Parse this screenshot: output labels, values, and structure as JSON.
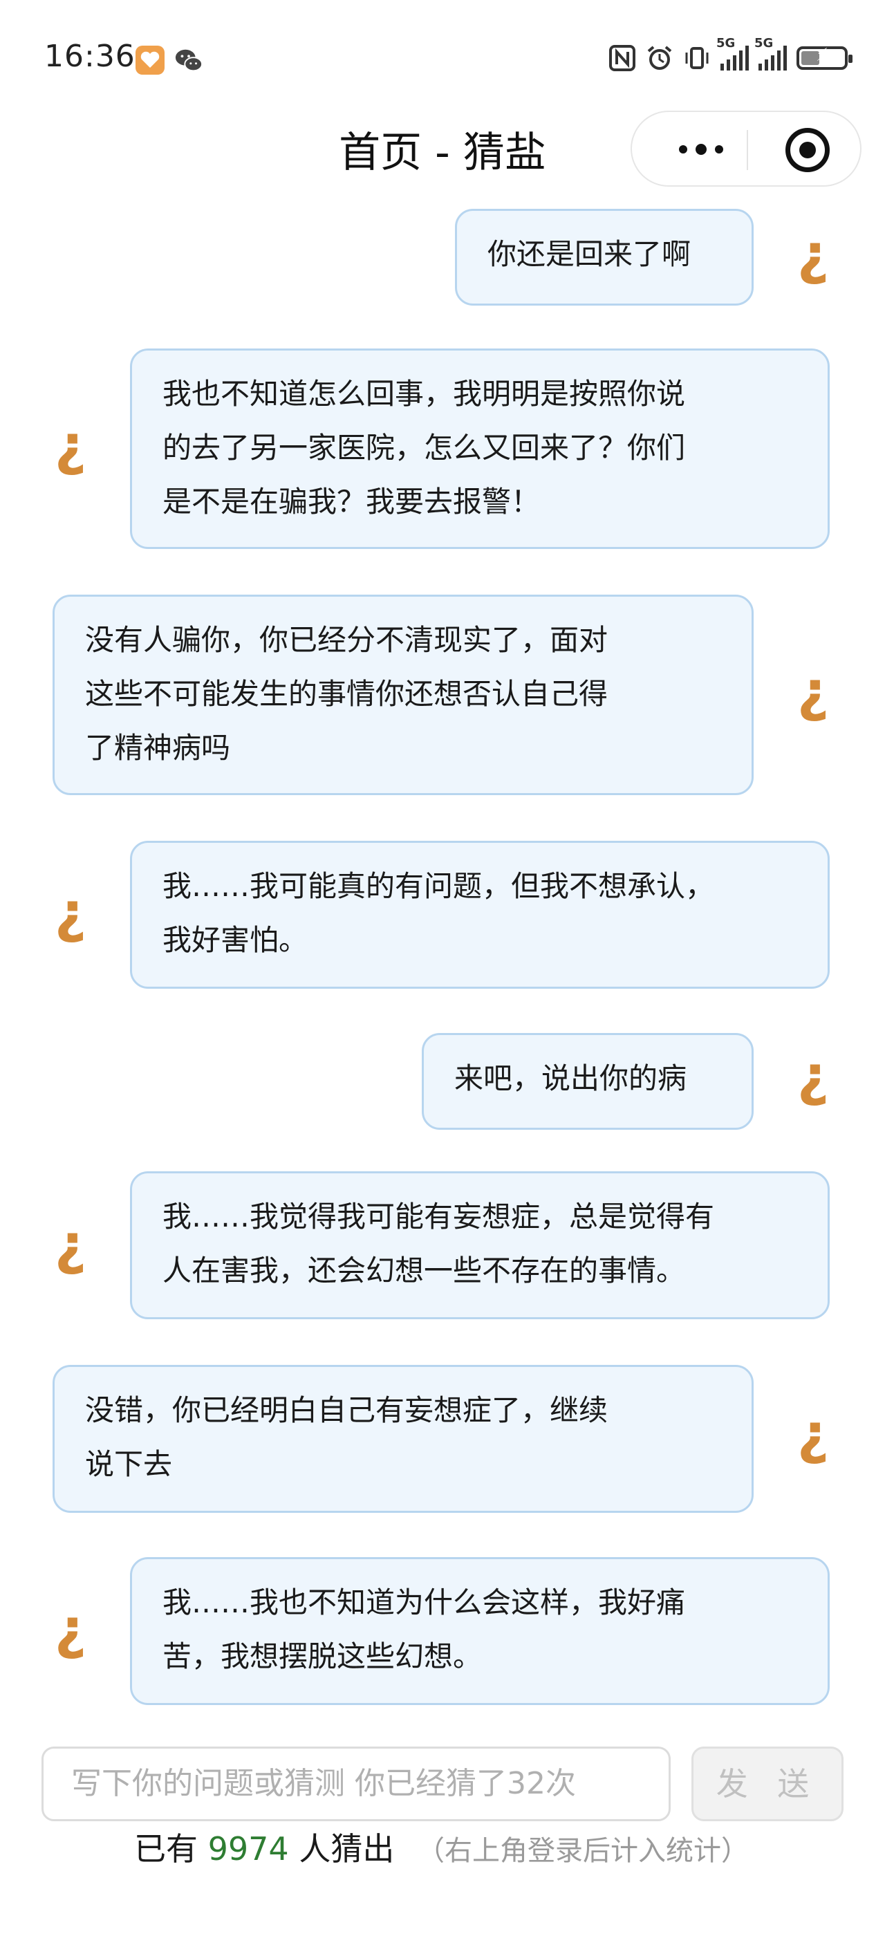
{
  "status_bar": {
    "time": "16:36",
    "left_icons": [
      "health-app-icon",
      "wechat-icon"
    ],
    "right_icons": [
      "nfc-icon",
      "alarm-icon",
      "vibrate-icon",
      "signal-5g-icon",
      "signal-5g-icon",
      "battery-charging-icon"
    ],
    "signal_label": "5G"
  },
  "header": {
    "title": "首页 - 猜盐",
    "more_icon": "more-dots-icon",
    "close_icon": "target-circle-icon"
  },
  "avatar_glyph": "¿",
  "messages": [
    {
      "side": "right",
      "lines": [
        "你还是回来了啊"
      ]
    },
    {
      "side": "left",
      "lines": [
        "我也不知道怎么回事，我明明是按照你说",
        "的去了另一家医院，怎么又回来了？你们",
        "是不是在骗我？我要去报警！"
      ]
    },
    {
      "side": "right",
      "lines": [
        "没有人骗你，你已经分不清现实了，面对",
        "这些不可能发生的事情你还想否认自己得",
        "了精神病吗"
      ]
    },
    {
      "side": "left",
      "lines": [
        "我……我可能真的有问题，但我不想承认，",
        "我好害怕。"
      ]
    },
    {
      "side": "right",
      "lines": [
        "来吧，说出你的病"
      ]
    },
    {
      "side": "left",
      "lines": [
        "我……我觉得我可能有妄想症，总是觉得有",
        "人在害我，还会幻想一些不存在的事情。"
      ]
    },
    {
      "side": "right",
      "lines": [
        "没错，你已经明白自己有妄想症了，继续",
        "说下去"
      ]
    },
    {
      "side": "left",
      "lines": [
        "我……我也不知道为什么会这样，我好痛",
        "苦，我想摆脱这些幻想。"
      ]
    }
  ],
  "footer": {
    "input_placeholder": "写下你的问题或猜测 你已经猜了32次",
    "send_label": "发 送",
    "stats_prefix": "已有",
    "stats_count": "9974",
    "stats_suffix": "人猜出",
    "stats_note": "（右上角登录后计入统计）"
  },
  "colors": {
    "bubble_bg": "#eef6fd",
    "bubble_border": "#b7d5ef",
    "avatar": "#d48a38",
    "count": "#2e7d32"
  }
}
